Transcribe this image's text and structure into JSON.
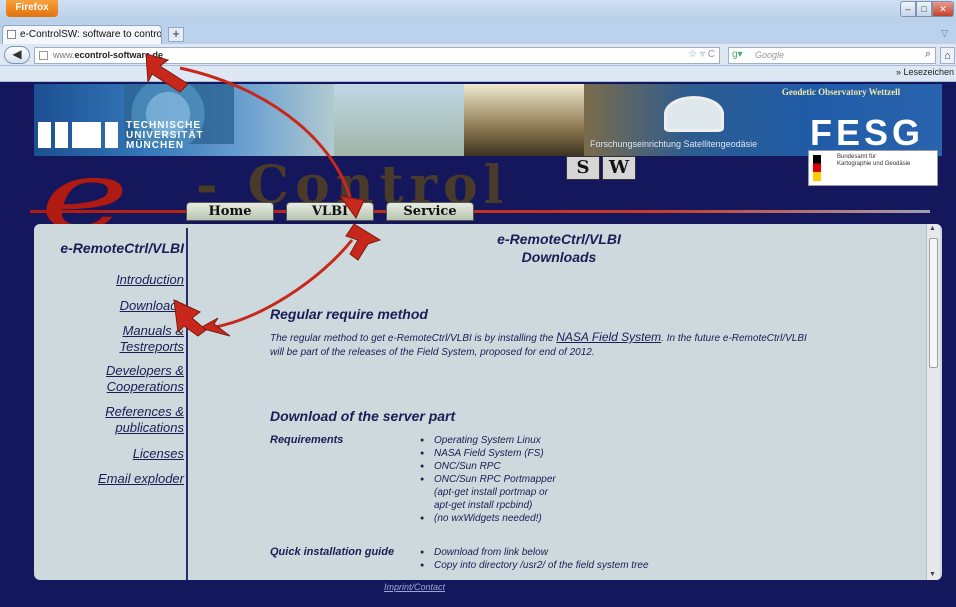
{
  "browser": {
    "menu_button": "Firefox",
    "tab_title": "e-ControlSW: software to control telesco...",
    "new_tab": "+",
    "url_prefix": "www.",
    "url_domain": "econtrol-software.de",
    "search_placeholder": "Google",
    "bookmarks_label": "» Lesezeichen"
  },
  "banner": {
    "university_line1": "TECHNISCHE",
    "university_line2": "UNIVERSITÄT",
    "university_line3": "MÜNCHEN",
    "observatory": "Geodetic Observatory Wettzell",
    "research_facility": "Forschungseinrichtung Satellitengeodäsie",
    "fesg": "FESG",
    "bkg_line1": "Bundesamt für",
    "bkg_line2": "Kartographie und Geodäsie"
  },
  "logo": {
    "e_letter": "e",
    "dash_word": "- Control",
    "badge_s": "S",
    "badge_w": "W"
  },
  "nav": {
    "home": "Home",
    "vlbi": "VLBI",
    "service": "Service"
  },
  "sidebar": {
    "title": "e-RemoteCtrl/VLBI",
    "items": [
      {
        "label": "Introduction"
      },
      {
        "label": "Downloads"
      },
      {
        "label": "Manuals &",
        "label2": "Testreports"
      },
      {
        "label": "Developers &",
        "label2": "Cooperations"
      },
      {
        "label": "References &",
        "label2": "publications"
      },
      {
        "label": "Licenses"
      },
      {
        "label": "Email exploder"
      }
    ]
  },
  "main": {
    "title_line1": "e-RemoteCtrl/VLBI",
    "title_line2": "Downloads",
    "section1_heading": "Regular require method",
    "section1_text_a": "The regular method to get e-RemoteCtrl/VLBI is by installing the ",
    "section1_link": "NASA Field System",
    "section1_text_b": ". In the future e-RemoteCtrl/VLBI",
    "section1_text_c": "will be part of the releases of the Field System, proposed for end of 2012.",
    "section2_heading": "Download of the server part",
    "requirements_label": "Requirements",
    "requirements": [
      "Operating System Linux",
      "NASA Field System (FS)",
      "ONC/Sun RPC",
      "ONC/Sun RPC Portmapper",
      "(apt-get install portmap or",
      "apt-get install rpcbind)",
      "(no wxWidgets needed!)"
    ],
    "quick_label": "Quick installation guide",
    "quick_steps": [
      "Download from link below",
      "Copy into directory /usr2/ of the field system tree"
    ]
  },
  "footer": {
    "imprint": "Imprint/Contact"
  },
  "colors": {
    "page_bg": "#15175c",
    "content_bg": "#ced9de",
    "text": "#1b1d55",
    "logo_red": "#b01a12",
    "arrow_red": "#c8281c"
  }
}
